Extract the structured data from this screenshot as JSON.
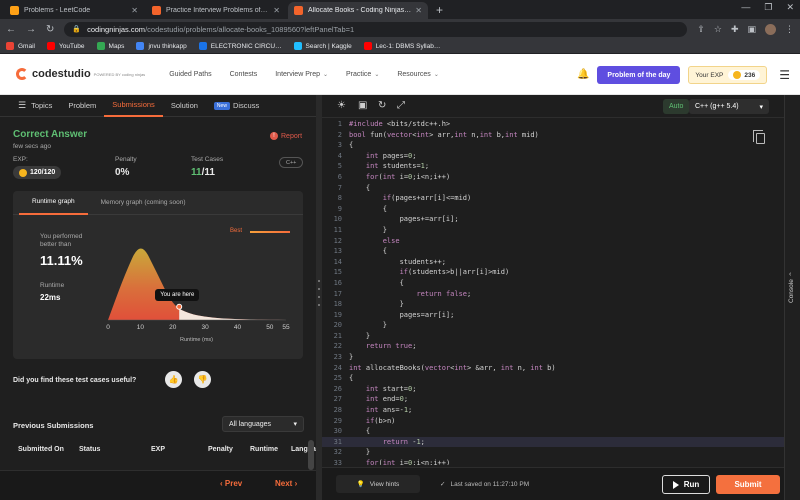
{
  "browser": {
    "tabs": [
      {
        "title": "Problems - LeetCode",
        "fav": "lc",
        "active": false
      },
      {
        "title": "Practice Interview Problems of to…",
        "fav": "cn",
        "active": false
      },
      {
        "title": "Allocate Books - Coding Ninjas C…",
        "fav": "cn",
        "active": true
      }
    ],
    "new_tab": "+",
    "url_host": "codingninjas.com",
    "url_path": "/codestudio/problems/allocate-books_1089560?leftPanelTab=1",
    "bookmarks": [
      "Gmail",
      "YouTube",
      "Maps",
      "jnvu thinkapp",
      "ELECTRONIC CIRCU…",
      "Search | Kaggle",
      "Lec-1: DBMS Syllab…"
    ],
    "bookmark_colors": [
      "#ea4335",
      "#ff0000",
      "#34a853",
      "#4285f4",
      "#1a73e8",
      "#20beff",
      "#ff0000"
    ]
  },
  "header": {
    "logo": "codestudio",
    "logo_sub": "POWERED BY coding ninjas",
    "menu": [
      {
        "label": "Guided Paths",
        "chevron": false
      },
      {
        "label": "Contests",
        "chevron": false
      },
      {
        "label": "Interview Prep",
        "chevron": true
      },
      {
        "label": "Practice",
        "chevron": true
      },
      {
        "label": "Resources",
        "chevron": true
      }
    ],
    "problem_of_day": "Problem of the day",
    "your_exp": "Your EXP",
    "exp_value": "236"
  },
  "left_tabs": {
    "topics": "Topics",
    "problem": "Problem",
    "submissions": "Submissions",
    "solution": "Solution",
    "new_badge": "New",
    "discuss": "Discuss"
  },
  "result": {
    "verdict": "Correct Answer",
    "time_ago": "few secs ago",
    "report": "Report",
    "exp_label": "EXP:",
    "exp_value": "120/120",
    "penalty_label": "Penalty",
    "penalty_value": "0%",
    "tc_label": "Test Cases",
    "tc_passed": "11",
    "tc_total": "/11",
    "lang_chip": "C++"
  },
  "graph": {
    "tab_runtime": "Runtime graph",
    "tab_memory": "Memory graph (coming soon)",
    "performed_1": "You performed",
    "performed_2": "better than",
    "percent": "11.11%",
    "runtime_label": "Runtime",
    "runtime_value": "22ms",
    "best": "Best",
    "here": "You are here",
    "x_title": "Runtime (ms)"
  },
  "chart_data": {
    "type": "area",
    "x": [
      0,
      5,
      10,
      15,
      20,
      25,
      30,
      35,
      40,
      45,
      50,
      55
    ],
    "xticks": [
      0,
      10,
      20,
      30,
      40,
      50,
      55
    ],
    "xlabel": "Runtime (ms)",
    "series": [
      {
        "name": "",
        "values": [
          0,
          55,
          100,
          60,
          18,
          8,
          4,
          2,
          1,
          0.5,
          0.2,
          0
        ]
      }
    ],
    "marker": {
      "x": 22,
      "label": "You are here"
    },
    "xlim": [
      0,
      55
    ]
  },
  "feedback": {
    "question": "Did you find these test cases useful?"
  },
  "previous": {
    "title": "Previous Submissions",
    "lang_filter": "All languages",
    "columns": [
      "Submitted On",
      "Status",
      "EXP",
      "Penalty",
      "Runtime",
      "Langua"
    ]
  },
  "nav": {
    "prev": "Prev",
    "next": "Next"
  },
  "editor": {
    "auto": "Auto",
    "language": "C++ (g++ 5.4)",
    "code": [
      "#include <bits/stdc++.h>",
      "bool fun(vector<int> arr,int n,int b,int mid)",
      "{",
      "    int pages=0;",
      "    int students=1;",
      "    for(int i=0;i<n;i++)",
      "    {",
      "        if(pages+arr[i]<=mid)",
      "        {",
      "            pages+=arr[i];",
      "        }",
      "        else",
      "        {",
      "            students++;",
      "            if(students>b||arr[i]>mid)",
      "            {",
      "                return false;",
      "            }",
      "            pages=arr[i];",
      "        }",
      "    }",
      "    return true;",
      "}",
      "int allocateBooks(vector<int> &arr, int n, int b)",
      "{",
      "    int start=0;",
      "    int end=0;",
      "    int ans=-1;",
      "    if(b>n)",
      "    {",
      "        return -1;",
      "    }",
      "    for(int i=0;i<n;i++)"
    ],
    "highlight_line": 31,
    "view_hints": "View hints",
    "saved": "Last saved on 11:27:10 PM",
    "run": "Run",
    "submit": "Submit",
    "console": "Console"
  }
}
